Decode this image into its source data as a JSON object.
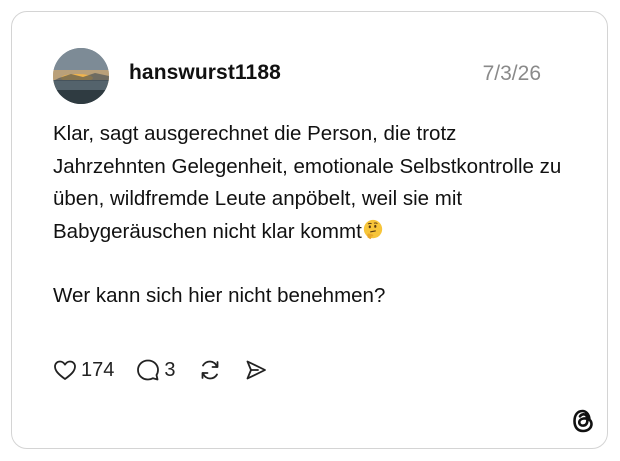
{
  "post": {
    "username": "hanswurst1188",
    "date": "7/3/26",
    "paragraph1": "Klar, sagt ausgerechnet die Person, die trotz Jahrzehnten Gelegenheit, emotionale Selbstkontrolle zu üben, wildfremde Leute anpöbelt, weil sie mit Babygeräuschen nicht klar kommt",
    "emoji": "thinking-face-icon",
    "paragraph2": "Wer kann sich hier nicht benehmen?"
  },
  "actions": {
    "likes": "174",
    "comments": "3"
  },
  "colors": {
    "border": "#d4d4d4",
    "text": "#111111",
    "date": "#8a8a8a"
  }
}
